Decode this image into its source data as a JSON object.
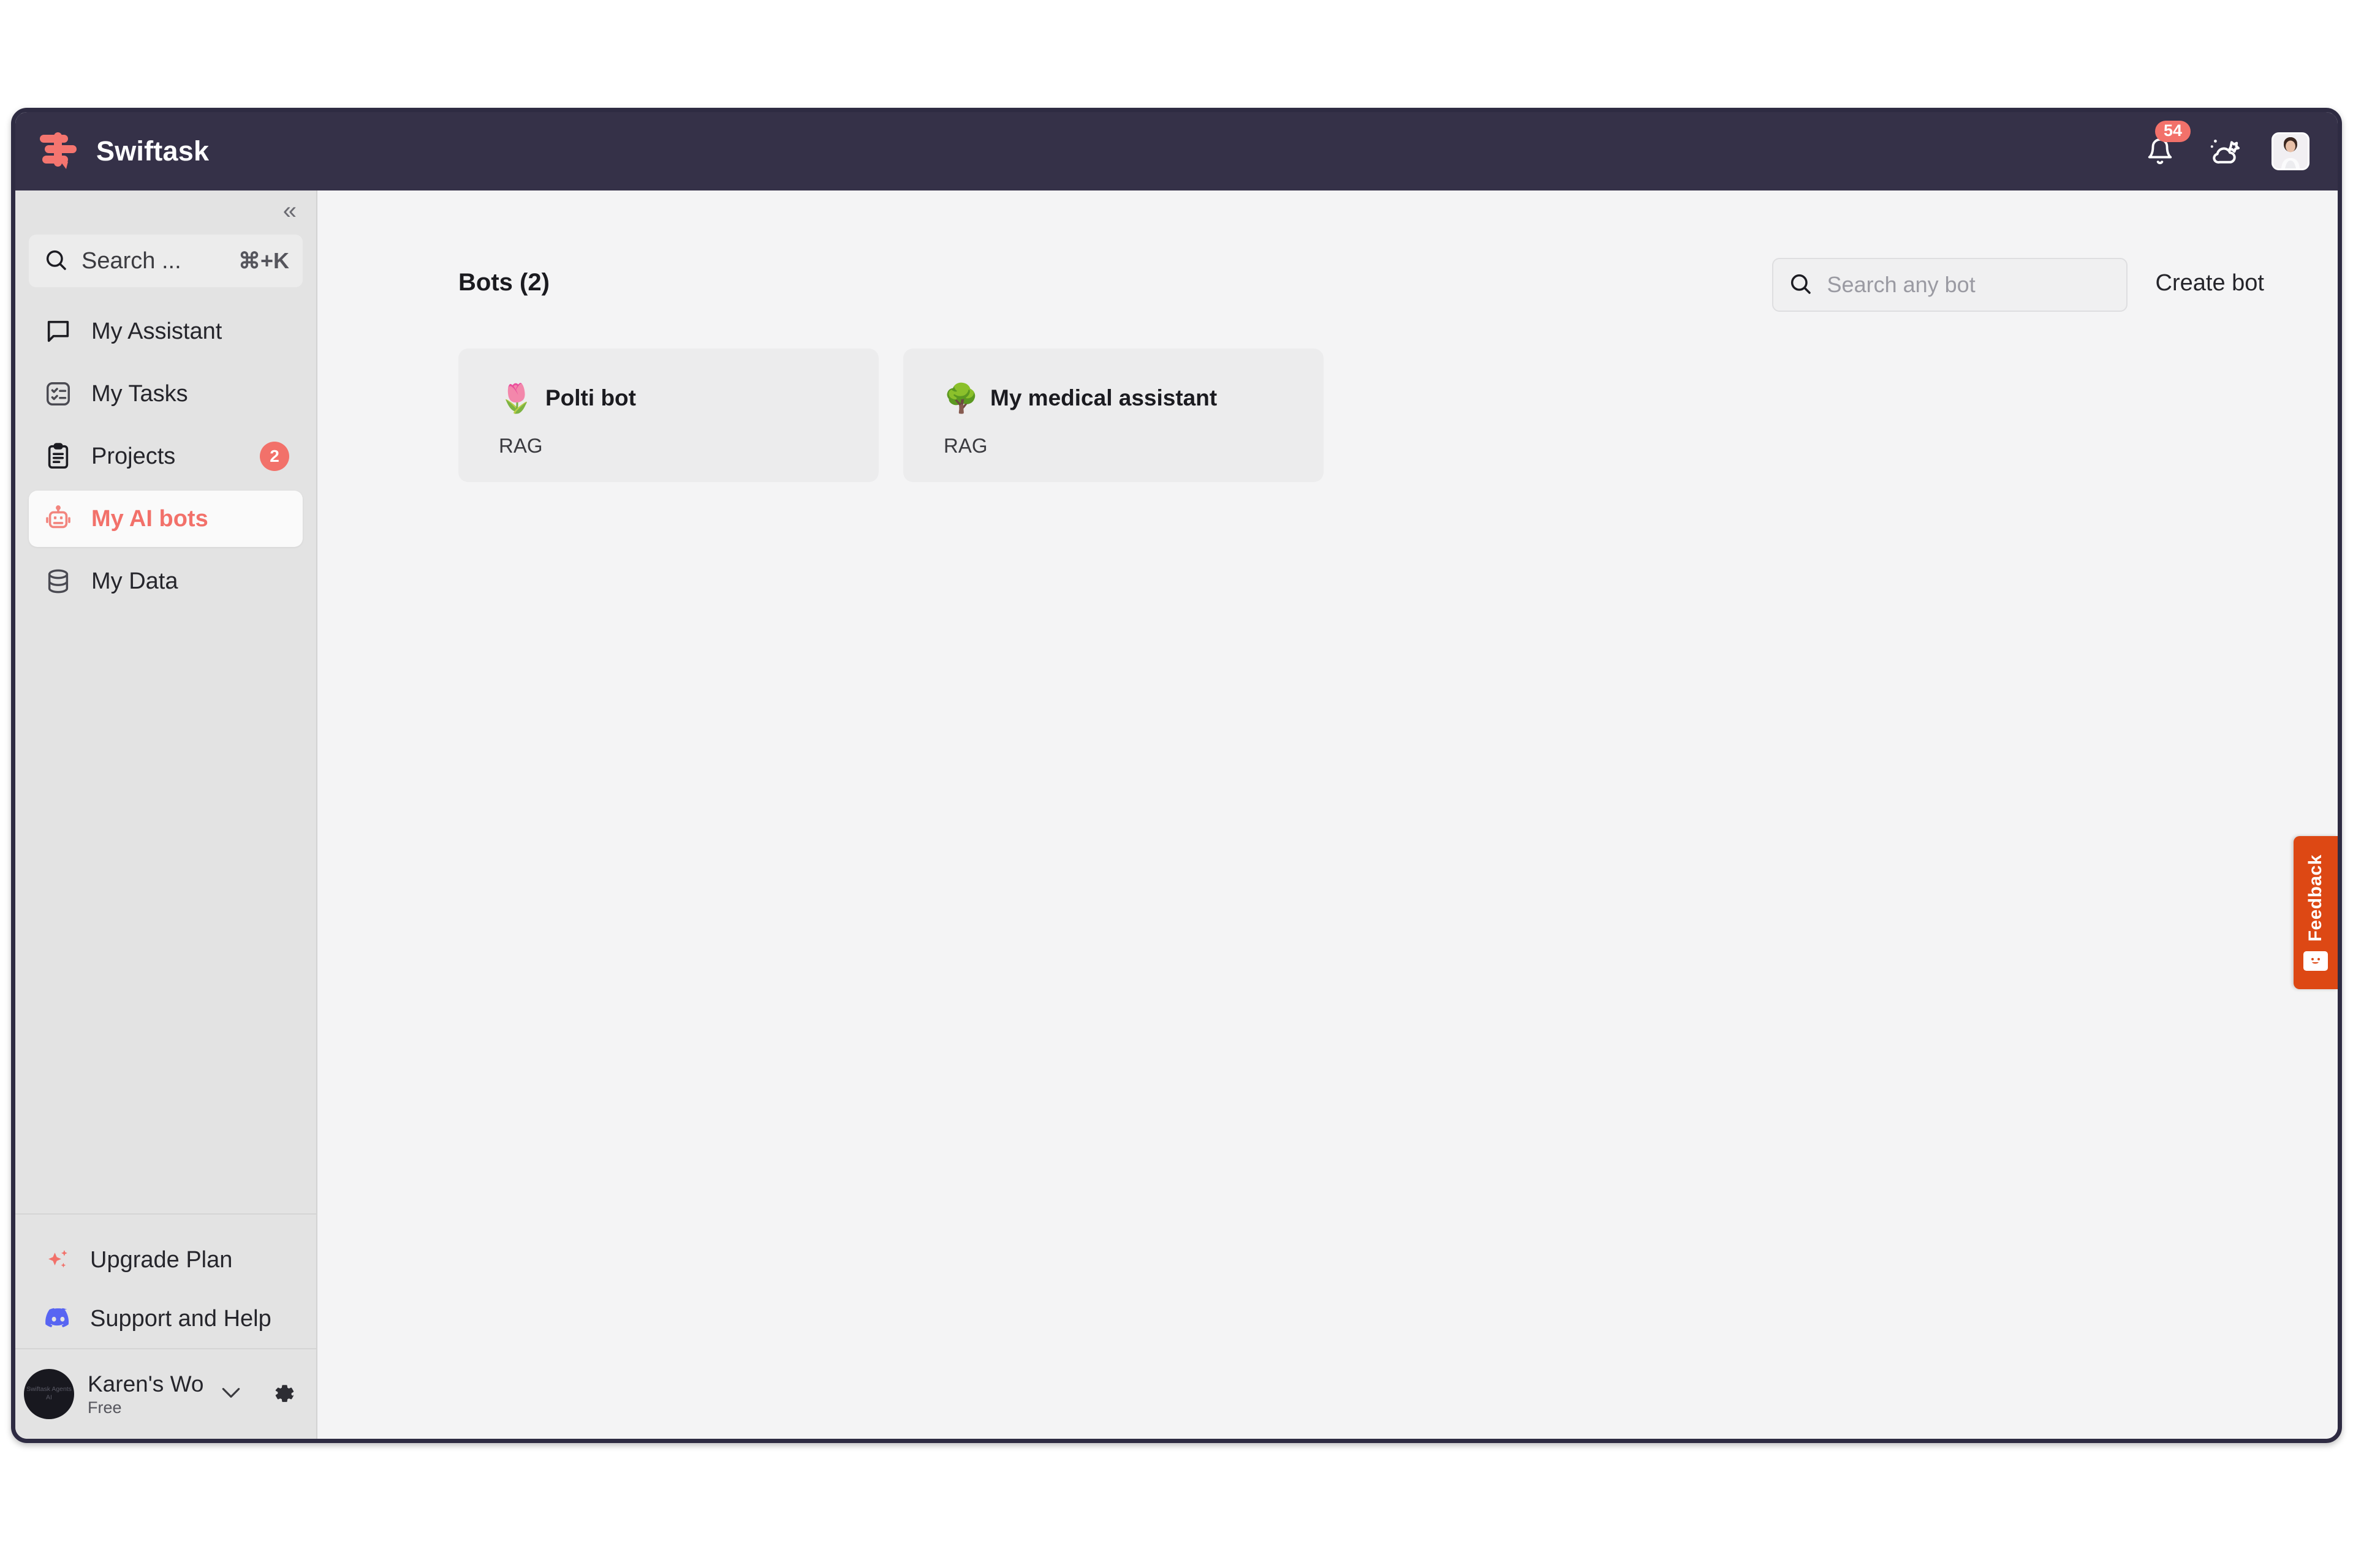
{
  "app": {
    "brand_name": "Swiftask",
    "logo_icon": "swiftask-logo",
    "header": {
      "notification_icon": "bell-icon",
      "notification_count": "54",
      "weather_icon": "cloud-sun-icon",
      "avatar_icon": "user-avatar"
    }
  },
  "sidebar": {
    "collapse_icon": "double-chevron-left-icon",
    "collapse_label": "«",
    "search": {
      "icon": "search-icon",
      "placeholder": "Search ...",
      "shortcut": "⌘+K"
    },
    "items": [
      {
        "label": "My Assistant",
        "icon": "chat-bubble-icon",
        "badge": "",
        "active": false
      },
      {
        "label": "My Tasks",
        "icon": "tasks-list-icon",
        "badge": "",
        "active": false
      },
      {
        "label": "Projects",
        "icon": "clipboard-icon",
        "badge": "2",
        "active": false
      },
      {
        "label": "My AI bots",
        "icon": "robot-icon",
        "badge": "",
        "active": true
      },
      {
        "label": "My Data",
        "icon": "database-icon",
        "badge": "",
        "active": false
      }
    ],
    "bottom_links": [
      {
        "label": "Upgrade Plan",
        "icon": "sparkles-icon"
      },
      {
        "label": "Support and Help",
        "icon": "discord-icon"
      }
    ],
    "workspace": {
      "avatar_icon": "workspace-avatar",
      "avatar_text": "Swiftask Agents AI",
      "name": "Karen's Wo",
      "plan": "Free",
      "chevron_icon": "chevron-down-icon",
      "settings_icon": "gear-icon"
    }
  },
  "main": {
    "title": "Bots (2)",
    "search": {
      "icon": "search-icon",
      "placeholder": "Search any bot",
      "value": ""
    },
    "create_button": "Create bot",
    "bots": [
      {
        "emoji": "🌷",
        "emoji_name": "tulip-emoji",
        "name": "Polti bot",
        "tag": "RAG"
      },
      {
        "emoji": "🌳",
        "emoji_name": "tree-emoji",
        "name": "My medical assistant",
        "tag": "RAG"
      }
    ]
  },
  "feedback": {
    "label": "Feedback",
    "icon": "smiley-face-icon"
  },
  "colors": {
    "header_bg": "#353148",
    "accent": "#f2716a",
    "sidebar_bg": "#e3e3e3",
    "main_bg": "#f4f4f5",
    "card_bg": "#ececed",
    "feedback_bg": "#dd4814",
    "discord_blue": "#5865f2"
  }
}
